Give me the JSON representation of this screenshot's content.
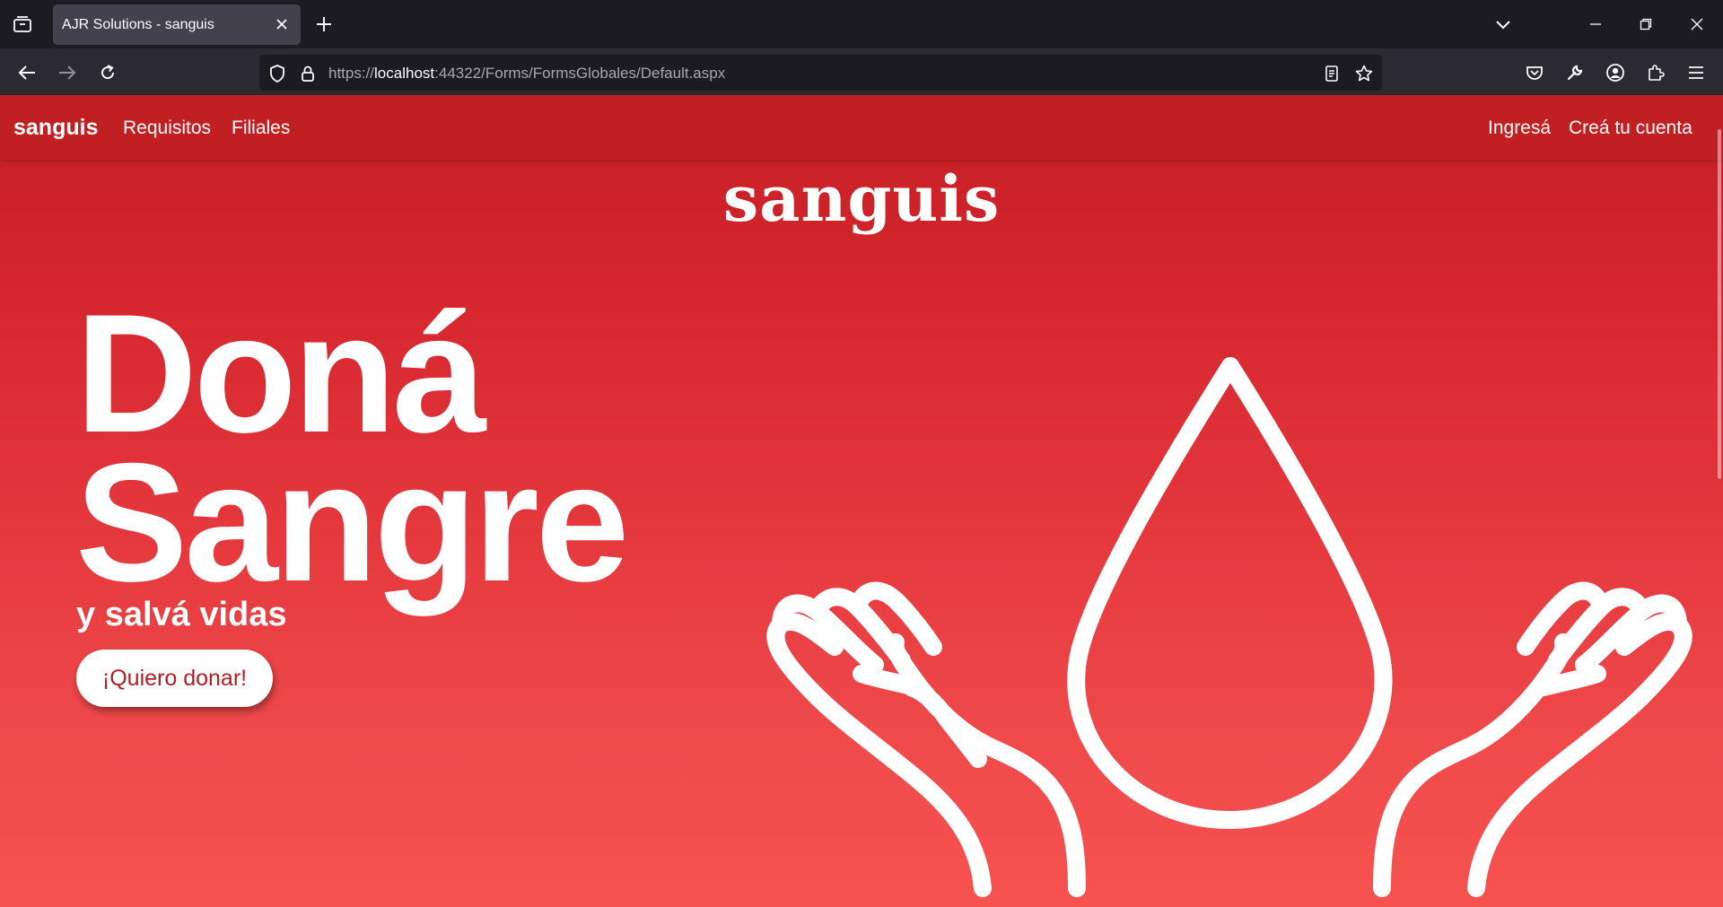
{
  "browser": {
    "tab_title": "AJR Solutions - sanguis",
    "url_prefix": "https://",
    "url_host": "localhost",
    "url_rest": ":44322/Forms/FormsGlobales/Default.aspx"
  },
  "site": {
    "brand": "sanguis",
    "nav": {
      "requirements": "Requisitos",
      "branches": "Filiales",
      "login": "Ingresá",
      "signup": "Creá tu cuenta"
    },
    "hero": {
      "logo": "sanguis",
      "line1": "Doná",
      "line2": "Sangre",
      "subtitle": "y salvá vidas",
      "cta": "¡Quiero donar!"
    }
  },
  "colors": {
    "primary": "#c21f23",
    "cta_text": "#b01e26"
  }
}
